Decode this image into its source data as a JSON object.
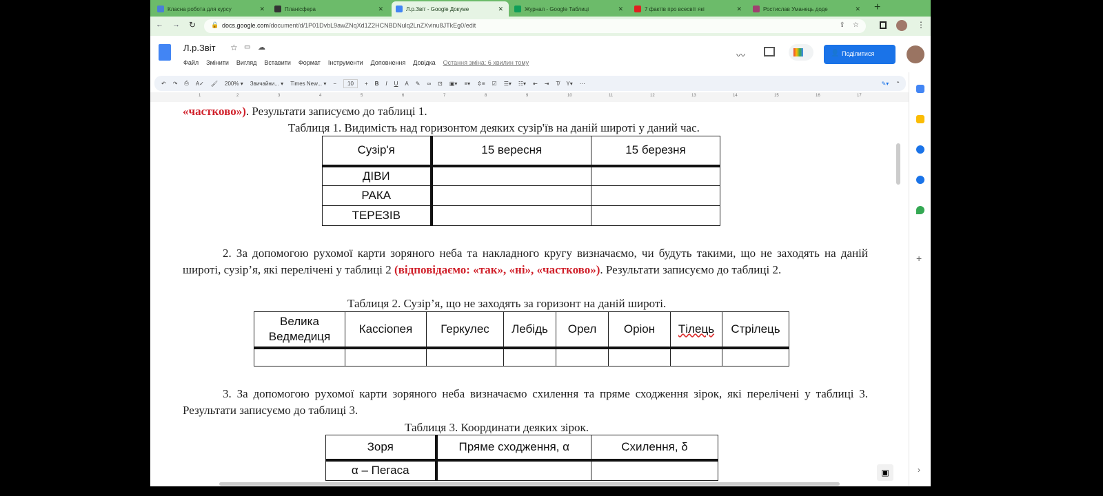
{
  "browser": {
    "tabs": [
      {
        "title": "Класна робота для курсу",
        "active": false,
        "color": "#4a7fd6"
      },
      {
        "title": "Планісфера",
        "active": false,
        "color": "#333"
      },
      {
        "title": "Л.р.Звіт - Google Докуме",
        "active": true,
        "color": "#4285f4"
      },
      {
        "title": "Журнал - Google Таблиці",
        "active": false,
        "color": "#0f9d58"
      },
      {
        "title": "7 фактів про всесвіт які",
        "active": false,
        "color": "#e02020"
      },
      {
        "title": "Ростислав Уманець доде",
        "active": false,
        "color": "#a04070"
      }
    ],
    "new_tab": "+",
    "url_domain": "docs.google.com",
    "url_path": "/document/d/1P01DvbL9awZNqXd1Z2HCNBDNulq2LnZXvinu8JTkEg0/edit"
  },
  "docs": {
    "title": "Л.р.Звіт",
    "menu": [
      "Файл",
      "Змінити",
      "Вигляд",
      "Вставити",
      "Формат",
      "Інструменти",
      "Доповнення",
      "Довідка"
    ],
    "last_edit": "Остання зміна: 6 хвилин тому",
    "share_label": "Поділитися",
    "toolbar": {
      "zoom": "200%",
      "style": "Звичайни...",
      "font": "Times New...",
      "size": "10"
    },
    "ruler": [
      "1",
      "2",
      "3",
      "4",
      "5",
      "6",
      "7",
      "8",
      "9",
      "10",
      "11",
      "12",
      "13",
      "14",
      "15",
      "16",
      "17"
    ]
  },
  "content": {
    "p1_red": "«частково»)",
    "p1_rest": ". Результати записуємо до таблиці 1.",
    "t1_caption": "Таблиця 1. Видимість над горизонтом деяких сузір'їв на даній широті у даний час.",
    "t1_headers": [
      "Сузір'я",
      "15 вересня",
      "15 березня"
    ],
    "t1_rows": [
      "ДІВИ",
      "РАКА",
      "ТЕРЕЗІВ"
    ],
    "p2_a": "2. За допомогою рухомої карти зоряного неба та накладного кругу визначаємо, чи будуть такими, що не заходять на даній широті, сузір’я, які перелічені у таблиці 2 ",
    "p2_red": "(відповідаємо: «так», «ні», «частково»)",
    "p2_b": ". Результати записуємо до таблиці 2.",
    "t2_caption": "Таблиця 2. Сузір’я, що не заходять за горизонт на даній широті.",
    "t2_headers": [
      "Велика Ведмедиця",
      "Кассіопея",
      "Геркулес",
      "Лебідь",
      "Орел",
      "Оріон",
      "Тілець",
      "Стрілець"
    ],
    "p3": "3. За допомогою рухомої карти зоряного неба визначаємо схилення та пряме сходження зірок, які перелічені у таблиці 3. Результати записуємо до таблиці 3.",
    "t3_caption": "Таблиця 3. Координати деяких зірок.",
    "t3_headers": [
      "Зоря",
      "Пряме сходження, α",
      "Схилення, δ"
    ],
    "t3_rows": [
      "α – Пегаса"
    ]
  }
}
